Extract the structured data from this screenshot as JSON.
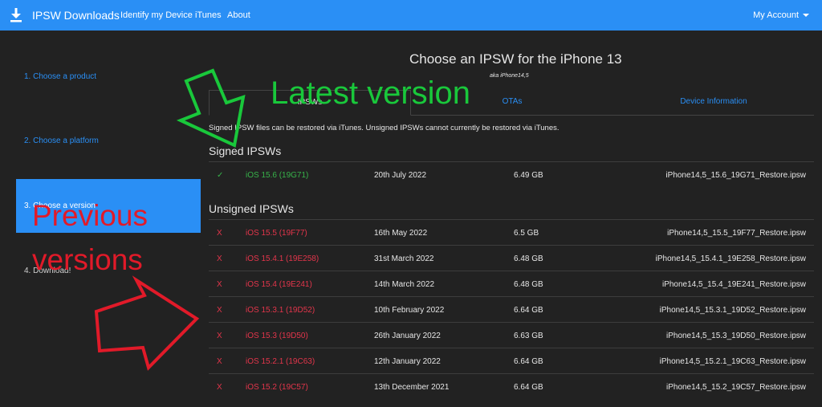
{
  "navbar": {
    "brand": "IPSW Downloads",
    "links": [
      "Identify my Device",
      "iTunes",
      "About"
    ],
    "account": "My Account",
    "logo_icon": "download-icon",
    "color": "#2a8ff5"
  },
  "sidebar": {
    "steps": [
      "1. Choose a product",
      "2. Choose a platform",
      "3. Choose a version",
      "4. Download!"
    ]
  },
  "main": {
    "title": "Choose an IPSW for the iPhone 13",
    "subtitle": "aka iPhone14,5",
    "tabs": [
      "IPSWs",
      "OTAs",
      "Device Information"
    ],
    "info": "Signed IPSW files can be restored via iTunes. Unsigned IPSWs cannot currently be restored via iTunes.",
    "signed_heading": "Signed IPSWs",
    "unsigned_heading": "Unsigned IPSWs",
    "signed": [
      {
        "mark": "✓",
        "version": "iOS 15.6 (19G71)",
        "date": "20th July 2022",
        "size": "6.49 GB",
        "file": "iPhone14,5_15.6_19G71_Restore.ipsw"
      }
    ],
    "unsigned": [
      {
        "mark": "X",
        "version": "iOS 15.5 (19F77)",
        "date": "16th May 2022",
        "size": "6.5 GB",
        "file": "iPhone14,5_15.5_19F77_Restore.ipsw"
      },
      {
        "mark": "X",
        "version": "iOS 15.4.1 (19E258)",
        "date": "31st March 2022",
        "size": "6.48 GB",
        "file": "iPhone14,5_15.4.1_19E258_Restore.ipsw"
      },
      {
        "mark": "X",
        "version": "iOS 15.4 (19E241)",
        "date": "14th March 2022",
        "size": "6.48 GB",
        "file": "iPhone14,5_15.4_19E241_Restore.ipsw"
      },
      {
        "mark": "X",
        "version": "iOS 15.3.1 (19D52)",
        "date": "10th February 2022",
        "size": "6.64 GB",
        "file": "iPhone14,5_15.3.1_19D52_Restore.ipsw"
      },
      {
        "mark": "X",
        "version": "iOS 15.3 (19D50)",
        "date": "26th January 2022",
        "size": "6.63 GB",
        "file": "iPhone14,5_15.3_19D50_Restore.ipsw"
      },
      {
        "mark": "X",
        "version": "iOS 15.2.1 (19C63)",
        "date": "12th January 2022",
        "size": "6.64 GB",
        "file": "iPhone14,5_15.2.1_19C63_Restore.ipsw"
      },
      {
        "mark": "X",
        "version": "iOS 15.2 (19C57)",
        "date": "13th December 2021",
        "size": "6.64 GB",
        "file": "iPhone14,5_15.2_19C57_Restore.ipsw"
      }
    ]
  },
  "annotations": {
    "latest": "Latest version",
    "previous_1": "Previous",
    "previous_2": "versions",
    "green": "#19c83b",
    "red": "#e11a29"
  }
}
